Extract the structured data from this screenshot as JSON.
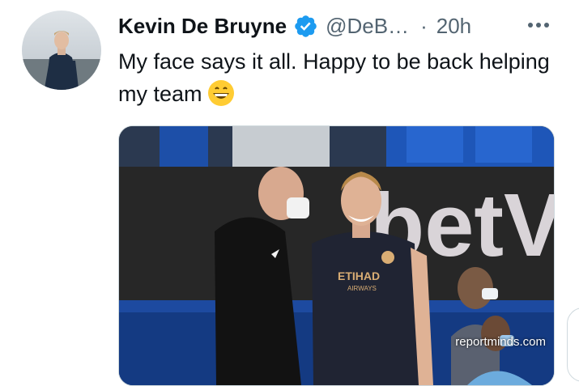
{
  "tweet": {
    "author_name": "Kevin De Bruyne",
    "handle": "@DeB…",
    "separator": "·",
    "time": "20h",
    "text": "My face says it all. Happy to be back helping my team",
    "emoji_icon": "grinning-face-emoji",
    "verified_icon": "verified-badge-icon",
    "more_icon": "more-options-icon"
  },
  "media": {
    "watermark": "reportminds.com",
    "sponsor_text": "ETIHAD",
    "sponsor_subtext": "AIRWAYS"
  },
  "colors": {
    "verified": "#1d9bf0",
    "text": "#0f1419",
    "secondary": "#536471",
    "sky_blue_kit": "#6cabdd"
  }
}
